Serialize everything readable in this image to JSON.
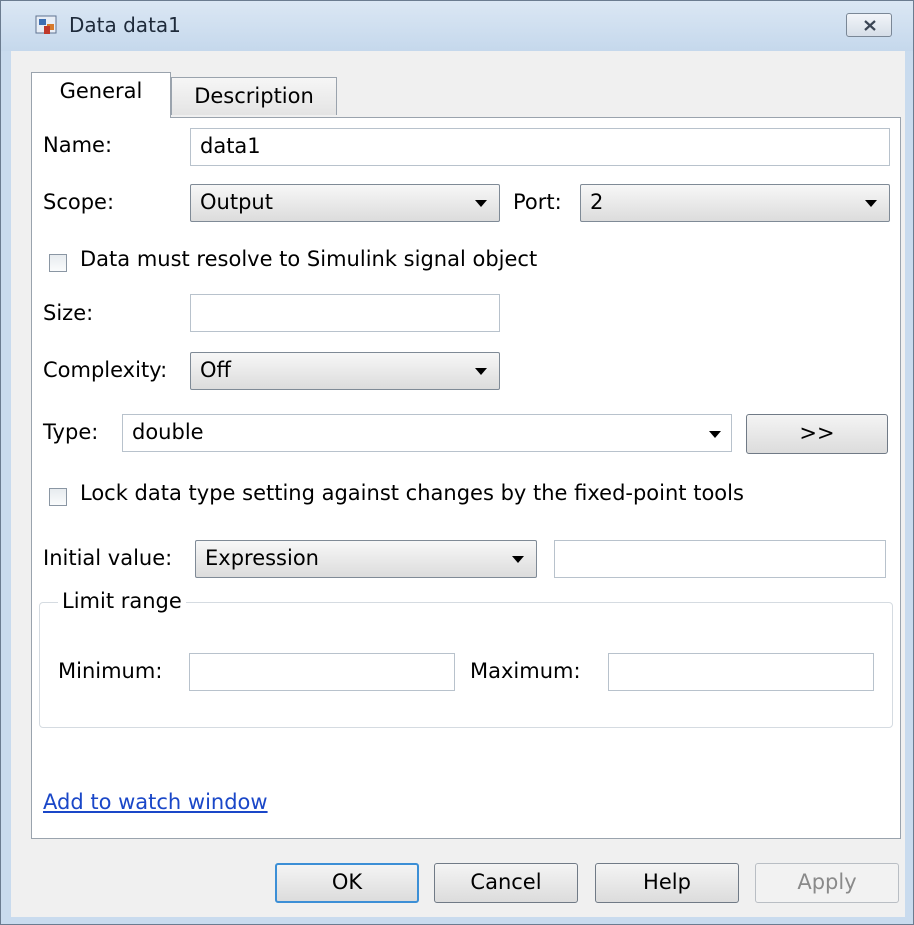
{
  "window": {
    "title": "Data data1",
    "close_icon": "close-icon",
    "app_icon": "simulink-data-icon"
  },
  "tabs": [
    {
      "label": "General",
      "active": true
    },
    {
      "label": "Description",
      "active": false
    }
  ],
  "form": {
    "name": {
      "label": "Name:",
      "value": "data1"
    },
    "scope": {
      "label": "Scope:",
      "value": "Output"
    },
    "port": {
      "label": "Port:",
      "value": "2"
    },
    "resolve_signal": {
      "label": "Data must resolve to Simulink signal object",
      "checked": false
    },
    "size": {
      "label": "Size:",
      "value": ""
    },
    "complexity": {
      "label": "Complexity:",
      "value": "Off"
    },
    "type": {
      "label": "Type:",
      "value": "double",
      "assistant_button": ">>"
    },
    "lock_type": {
      "label": "Lock data type setting against changes by the fixed-point tools",
      "checked": false
    },
    "initial_value": {
      "label": "Initial value:",
      "mode": "Expression",
      "value": ""
    },
    "limit_range": {
      "legend": "Limit range",
      "minimum": {
        "label": "Minimum:",
        "value": ""
      },
      "maximum": {
        "label": "Maximum:",
        "value": ""
      }
    },
    "watch_link": "Add to watch window"
  },
  "buttons": {
    "ok": "OK",
    "cancel": "Cancel",
    "help": "Help",
    "apply": "Apply"
  },
  "colors": {
    "link": "#1a47c8",
    "default_button_border": "#3c8fd6",
    "frame": "#c9dbee"
  }
}
